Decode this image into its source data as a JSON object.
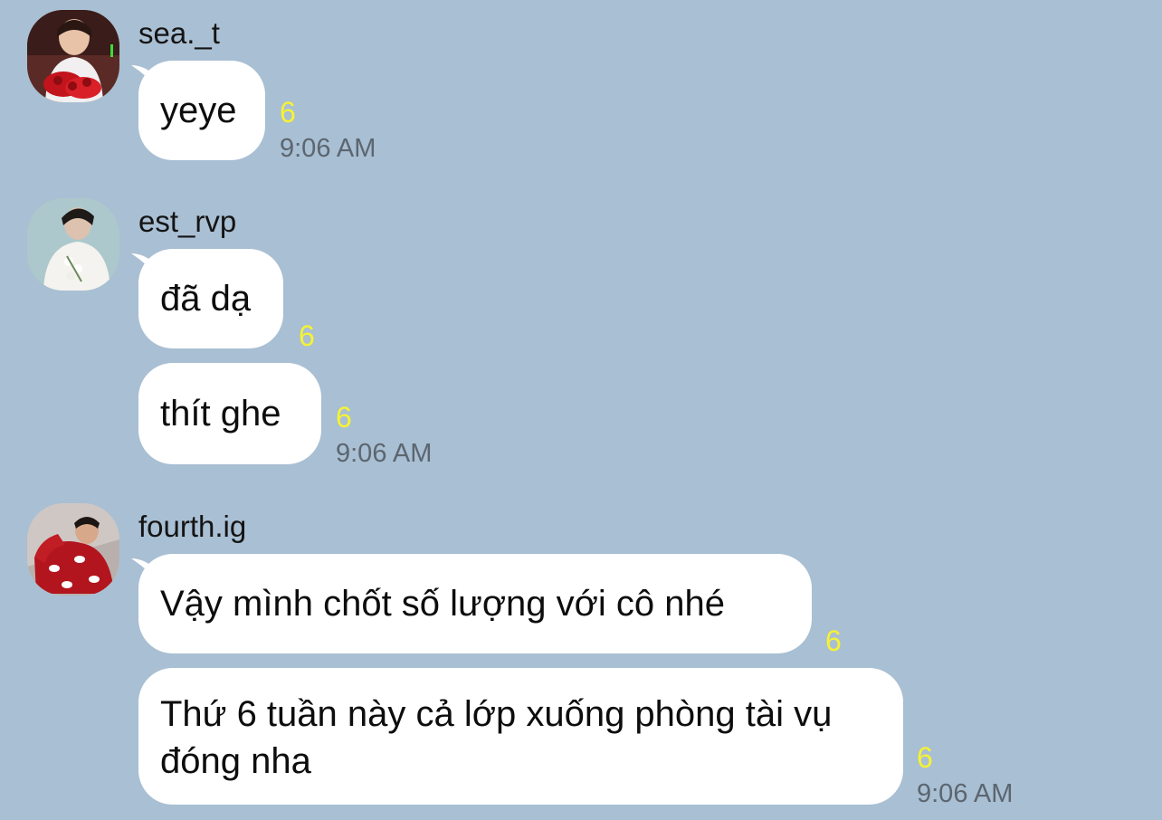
{
  "messages": [
    {
      "sender": "sea._t",
      "bubbles": [
        {
          "text": "yeye",
          "read": "6",
          "time": "9:06 AM"
        }
      ]
    },
    {
      "sender": "est_rvp",
      "bubbles": [
        {
          "text": "đã dạ",
          "read": "6"
        },
        {
          "text": "thít ghe",
          "read": "6",
          "time": "9:06 AM"
        }
      ]
    },
    {
      "sender": "fourth.ig",
      "bubbles": [
        {
          "text": "Vậy mình chốt số lượng với cô nhé",
          "read": "6"
        },
        {
          "text": "Thứ 6 tuần này cả lớp xuống phòng tài vụ đóng nha",
          "read": "6",
          "time": "9:06 AM"
        }
      ]
    }
  ],
  "colors": {
    "background": "#a9bfd3",
    "bubble": "#ffffff",
    "read_count": "#f6f233",
    "timestamp": "#5c6670"
  }
}
